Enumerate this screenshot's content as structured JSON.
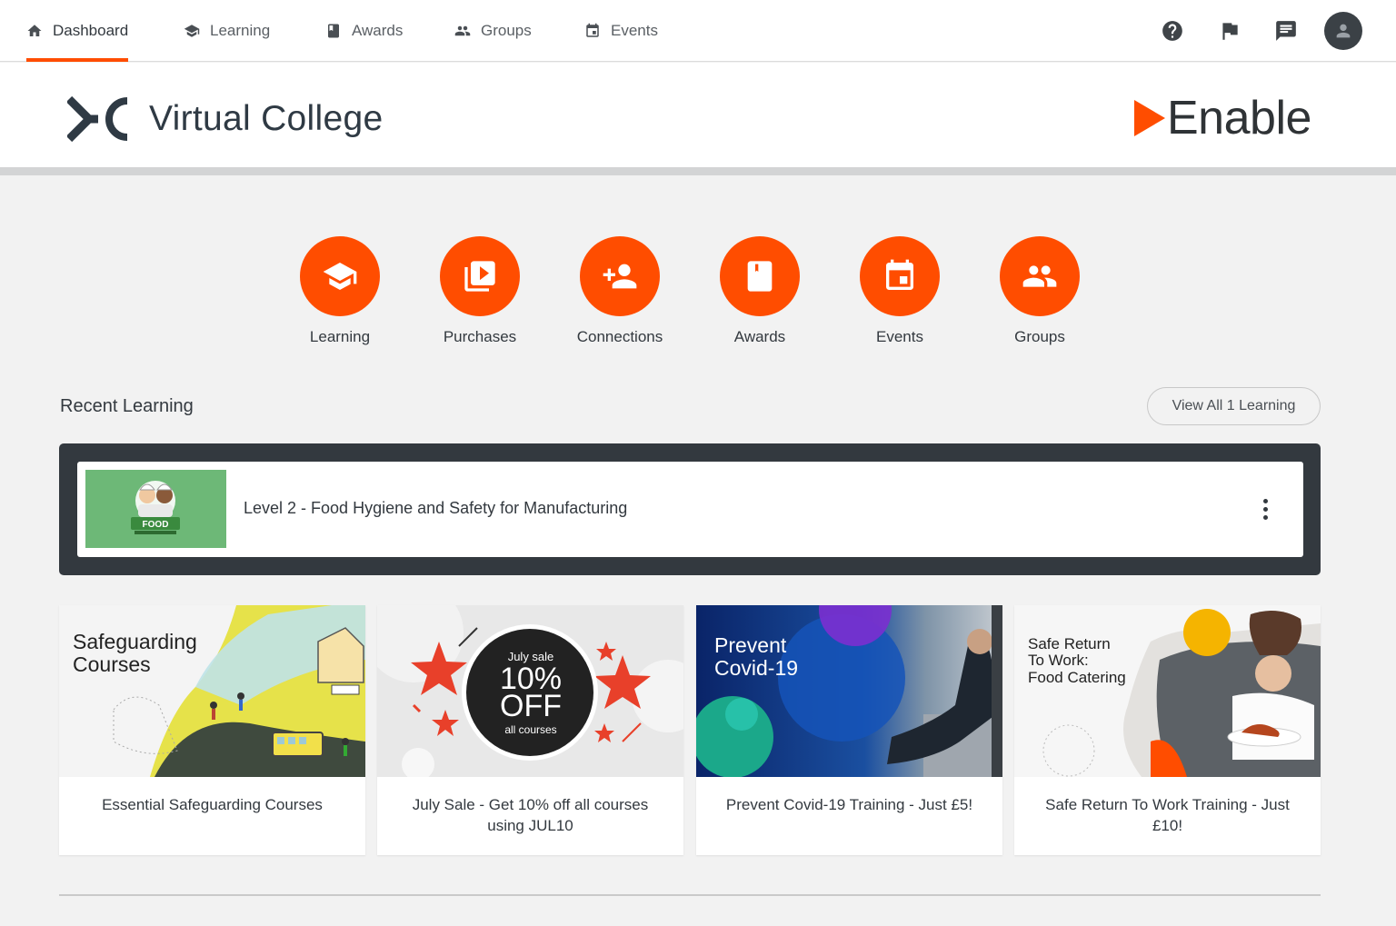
{
  "nav": {
    "items": [
      {
        "label": "Dashboard",
        "icon": "home-icon",
        "active": true
      },
      {
        "label": "Learning",
        "icon": "graduation-cap-icon",
        "active": false
      },
      {
        "label": "Awards",
        "icon": "bookmark-book-icon",
        "active": false
      },
      {
        "label": "Groups",
        "icon": "people-icon",
        "active": false
      },
      {
        "label": "Events",
        "icon": "calendar-icon",
        "active": false
      }
    ],
    "right_icons": [
      "help-icon",
      "flag-icon",
      "chat-icon",
      "avatar-icon"
    ]
  },
  "brand": {
    "name": "Virtual College",
    "partner": "Enable"
  },
  "quick_links": [
    {
      "label": "Learning",
      "icon": "graduation-cap-icon"
    },
    {
      "label": "Purchases",
      "icon": "video-library-icon"
    },
    {
      "label": "Connections",
      "icon": "person-add-icon"
    },
    {
      "label": "Awards",
      "icon": "book-icon"
    },
    {
      "label": "Events",
      "icon": "calendar-icon"
    },
    {
      "label": "Groups",
      "icon": "people-icon"
    }
  ],
  "recent": {
    "title": "Recent Learning",
    "view_all": "View All 1 Learning",
    "items": [
      {
        "title": "Level 2 - Food Hygiene and Safety for Manufacturing",
        "thumb_text": "FOOD"
      }
    ]
  },
  "promos": [
    {
      "image_text": "Safeguarding\nCourses",
      "caption": "Essential Safeguarding Courses"
    },
    {
      "image_text_top": "July sale",
      "image_text_big1": "10%",
      "image_text_big2": "OFF",
      "image_text_bottom": "all courses",
      "caption": "July Sale - Get 10% off all courses using JUL10"
    },
    {
      "image_text": "Prevent\nCovid-19",
      "caption": "Prevent Covid-19 Training - Just £5!"
    },
    {
      "image_text": "Safe Return\nTo Work:\nFood Catering",
      "caption": "Safe Return To Work Training - Just £10!"
    }
  ],
  "colors": {
    "accent": "#ff4d00",
    "dark": "#33393f",
    "background": "#f2f2f2"
  }
}
